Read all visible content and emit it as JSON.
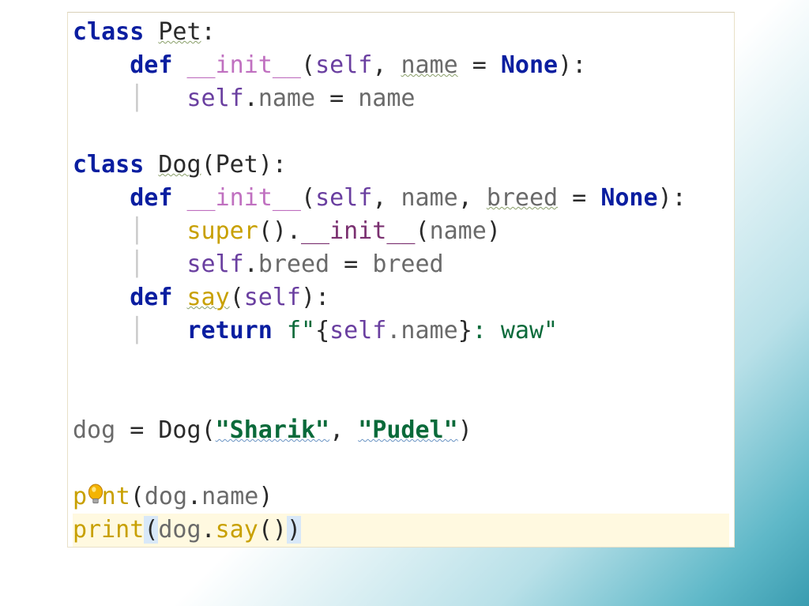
{
  "code": {
    "kw_class": "class",
    "kw_def": "def",
    "kw_return": "return",
    "cls_Pet": "Pet",
    "cls_Dog": "Dog",
    "dunder_init": "__init__",
    "fn_say": "say",
    "fn_super": "super",
    "fn_print": "print",
    "self": "self",
    "prm_name": "name",
    "prm_breed": "breed",
    "none": "None",
    "str_sharik": "\"Sharik\"",
    "str_pudel": "\"Pudel\"",
    "fstr_open": "f\"",
    "fstr_mid": ".name",
    "fstr_txt": ": waw\"",
    "var_dog": "dog",
    "op_eq": " = ",
    "colon": ":",
    "comma": ", ",
    "lparen": "(",
    "rparen": ")",
    "lbrace": "{",
    "rbrace": "}",
    "dot": "."
  }
}
